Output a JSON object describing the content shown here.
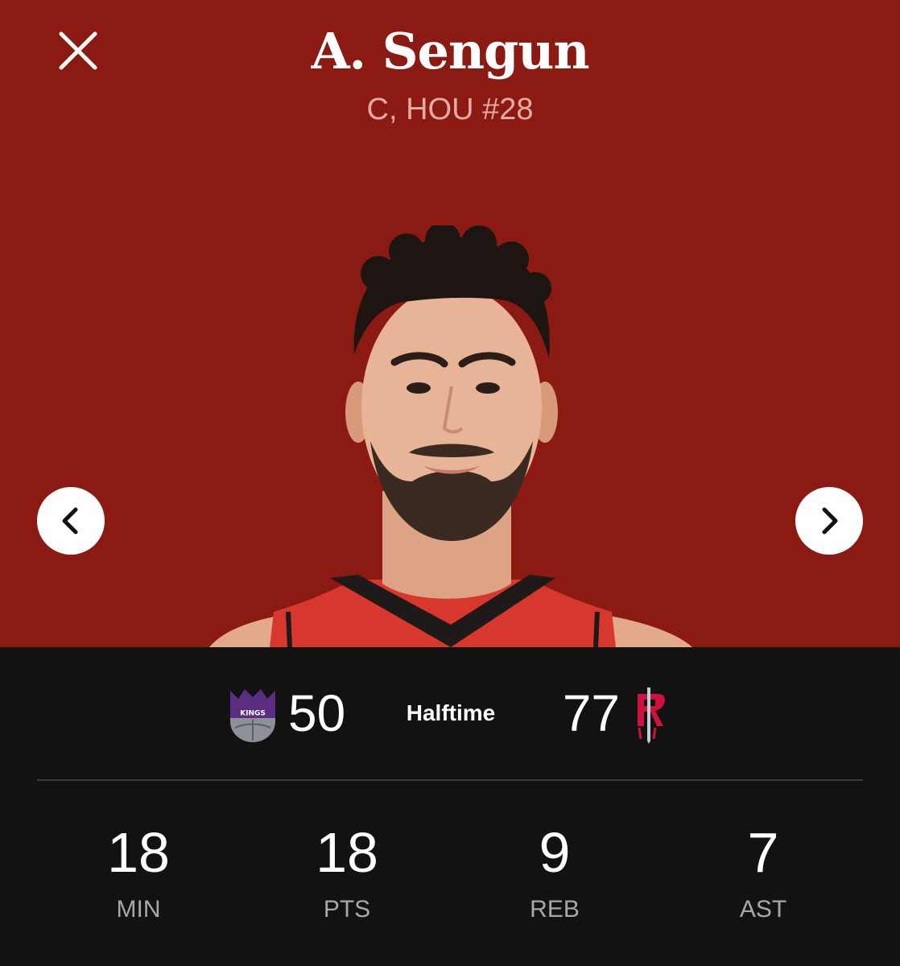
{
  "header": {
    "player_name": "A. Sengun",
    "player_meta": "C, HOU #28",
    "close_icon": "close-icon",
    "prev_icon": "chevron-left-icon",
    "next_icon": "chevron-right-icon"
  },
  "colors": {
    "hero_background": "#8b1a13",
    "panel_background": "#121212",
    "jersey": "#d7372c",
    "kings_purple": "#5a2d81",
    "rockets_red": "#ce1141"
  },
  "game": {
    "away_team_logo": "sacramento-kings-logo",
    "away_logo_text": "SACRAMENTO KINGS",
    "away_score": "50",
    "status": "Halftime",
    "home_score": "77",
    "home_team_logo": "houston-rockets-logo"
  },
  "stats": [
    {
      "value": "18",
      "label": "MIN"
    },
    {
      "value": "18",
      "label": "PTS"
    },
    {
      "value": "9",
      "label": "REB"
    },
    {
      "value": "7",
      "label": "AST"
    }
  ]
}
